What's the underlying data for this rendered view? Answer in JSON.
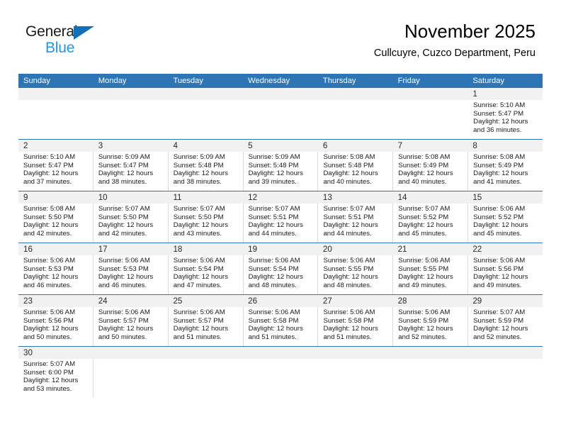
{
  "brand": {
    "name_part1": "General",
    "name_part2": "Blue",
    "triangle_color": "#1071BA",
    "blue_text_color": "#2196E3"
  },
  "header": {
    "title": "November 2025",
    "subtitle": "Cullcuyre, Cuzco Department, Peru"
  },
  "theme": {
    "header_bg": "#2E75B6",
    "daynum_bg": "#F1F1F1",
    "row_separator": "#2E75B6",
    "cell_border": "#d9d9d9"
  },
  "weekdays": [
    "Sunday",
    "Monday",
    "Tuesday",
    "Wednesday",
    "Thursday",
    "Friday",
    "Saturday"
  ],
  "weeks": [
    [
      {
        "day": "",
        "lines": []
      },
      {
        "day": "",
        "lines": []
      },
      {
        "day": "",
        "lines": []
      },
      {
        "day": "",
        "lines": []
      },
      {
        "day": "",
        "lines": []
      },
      {
        "day": "",
        "lines": []
      },
      {
        "day": "1",
        "lines": [
          "Sunrise: 5:10 AM",
          "Sunset: 5:47 PM",
          "Daylight: 12 hours",
          "and 36 minutes."
        ]
      }
    ],
    [
      {
        "day": "2",
        "lines": [
          "Sunrise: 5:10 AM",
          "Sunset: 5:47 PM",
          "Daylight: 12 hours",
          "and 37 minutes."
        ]
      },
      {
        "day": "3",
        "lines": [
          "Sunrise: 5:09 AM",
          "Sunset: 5:47 PM",
          "Daylight: 12 hours",
          "and 38 minutes."
        ]
      },
      {
        "day": "4",
        "lines": [
          "Sunrise: 5:09 AM",
          "Sunset: 5:48 PM",
          "Daylight: 12 hours",
          "and 38 minutes."
        ]
      },
      {
        "day": "5",
        "lines": [
          "Sunrise: 5:09 AM",
          "Sunset: 5:48 PM",
          "Daylight: 12 hours",
          "and 39 minutes."
        ]
      },
      {
        "day": "6",
        "lines": [
          "Sunrise: 5:08 AM",
          "Sunset: 5:48 PM",
          "Daylight: 12 hours",
          "and 40 minutes."
        ]
      },
      {
        "day": "7",
        "lines": [
          "Sunrise: 5:08 AM",
          "Sunset: 5:49 PM",
          "Daylight: 12 hours",
          "and 40 minutes."
        ]
      },
      {
        "day": "8",
        "lines": [
          "Sunrise: 5:08 AM",
          "Sunset: 5:49 PM",
          "Daylight: 12 hours",
          "and 41 minutes."
        ]
      }
    ],
    [
      {
        "day": "9",
        "lines": [
          "Sunrise: 5:08 AM",
          "Sunset: 5:50 PM",
          "Daylight: 12 hours",
          "and 42 minutes."
        ]
      },
      {
        "day": "10",
        "lines": [
          "Sunrise: 5:07 AM",
          "Sunset: 5:50 PM",
          "Daylight: 12 hours",
          "and 42 minutes."
        ]
      },
      {
        "day": "11",
        "lines": [
          "Sunrise: 5:07 AM",
          "Sunset: 5:50 PM",
          "Daylight: 12 hours",
          "and 43 minutes."
        ]
      },
      {
        "day": "12",
        "lines": [
          "Sunrise: 5:07 AM",
          "Sunset: 5:51 PM",
          "Daylight: 12 hours",
          "and 44 minutes."
        ]
      },
      {
        "day": "13",
        "lines": [
          "Sunrise: 5:07 AM",
          "Sunset: 5:51 PM",
          "Daylight: 12 hours",
          "and 44 minutes."
        ]
      },
      {
        "day": "14",
        "lines": [
          "Sunrise: 5:07 AM",
          "Sunset: 5:52 PM",
          "Daylight: 12 hours",
          "and 45 minutes."
        ]
      },
      {
        "day": "15",
        "lines": [
          "Sunrise: 5:06 AM",
          "Sunset: 5:52 PM",
          "Daylight: 12 hours",
          "and 45 minutes."
        ]
      }
    ],
    [
      {
        "day": "16",
        "lines": [
          "Sunrise: 5:06 AM",
          "Sunset: 5:53 PM",
          "Daylight: 12 hours",
          "and 46 minutes."
        ]
      },
      {
        "day": "17",
        "lines": [
          "Sunrise: 5:06 AM",
          "Sunset: 5:53 PM",
          "Daylight: 12 hours",
          "and 46 minutes."
        ]
      },
      {
        "day": "18",
        "lines": [
          "Sunrise: 5:06 AM",
          "Sunset: 5:54 PM",
          "Daylight: 12 hours",
          "and 47 minutes."
        ]
      },
      {
        "day": "19",
        "lines": [
          "Sunrise: 5:06 AM",
          "Sunset: 5:54 PM",
          "Daylight: 12 hours",
          "and 48 minutes."
        ]
      },
      {
        "day": "20",
        "lines": [
          "Sunrise: 5:06 AM",
          "Sunset: 5:55 PM",
          "Daylight: 12 hours",
          "and 48 minutes."
        ]
      },
      {
        "day": "21",
        "lines": [
          "Sunrise: 5:06 AM",
          "Sunset: 5:55 PM",
          "Daylight: 12 hours",
          "and 49 minutes."
        ]
      },
      {
        "day": "22",
        "lines": [
          "Sunrise: 5:06 AM",
          "Sunset: 5:56 PM",
          "Daylight: 12 hours",
          "and 49 minutes."
        ]
      }
    ],
    [
      {
        "day": "23",
        "lines": [
          "Sunrise: 5:06 AM",
          "Sunset: 5:56 PM",
          "Daylight: 12 hours",
          "and 50 minutes."
        ]
      },
      {
        "day": "24",
        "lines": [
          "Sunrise: 5:06 AM",
          "Sunset: 5:57 PM",
          "Daylight: 12 hours",
          "and 50 minutes."
        ]
      },
      {
        "day": "25",
        "lines": [
          "Sunrise: 5:06 AM",
          "Sunset: 5:57 PM",
          "Daylight: 12 hours",
          "and 51 minutes."
        ]
      },
      {
        "day": "26",
        "lines": [
          "Sunrise: 5:06 AM",
          "Sunset: 5:58 PM",
          "Daylight: 12 hours",
          "and 51 minutes."
        ]
      },
      {
        "day": "27",
        "lines": [
          "Sunrise: 5:06 AM",
          "Sunset: 5:58 PM",
          "Daylight: 12 hours",
          "and 51 minutes."
        ]
      },
      {
        "day": "28",
        "lines": [
          "Sunrise: 5:06 AM",
          "Sunset: 5:59 PM",
          "Daylight: 12 hours",
          "and 52 minutes."
        ]
      },
      {
        "day": "29",
        "lines": [
          "Sunrise: 5:07 AM",
          "Sunset: 5:59 PM",
          "Daylight: 12 hours",
          "and 52 minutes."
        ]
      }
    ],
    [
      {
        "day": "30",
        "lines": [
          "Sunrise: 5:07 AM",
          "Sunset: 6:00 PM",
          "Daylight: 12 hours",
          "and 53 minutes."
        ]
      },
      {
        "day": "",
        "lines": []
      },
      {
        "day": "",
        "lines": []
      },
      {
        "day": "",
        "lines": []
      },
      {
        "day": "",
        "lines": []
      },
      {
        "day": "",
        "lines": []
      },
      {
        "day": "",
        "lines": []
      }
    ]
  ]
}
